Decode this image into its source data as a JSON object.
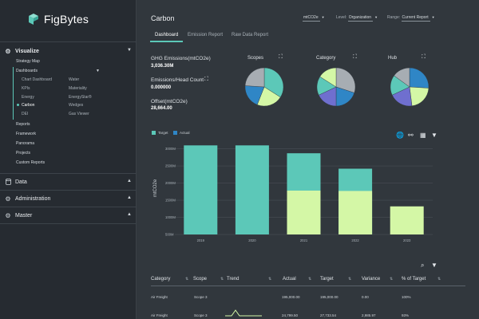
{
  "app": {
    "name": "FigBytes"
  },
  "sidebar": {
    "visualize_label": "Visualize",
    "strategy_map": "Strategy Map",
    "dashboards": "Dashboards",
    "dash_col1": [
      "Chart Dashboard",
      "KPIs",
      "Energy",
      "Carbon",
      "DEI"
    ],
    "dash_col2": [
      "Water",
      "Materiality",
      "EnergyStar®",
      "Wedges",
      "Gas Viewer"
    ],
    "reports": "Reports",
    "framework": "Framework",
    "panorama": "Panorama",
    "projects": "Projects",
    "custom_reports": "Custom Reports",
    "data_label": "Data",
    "administration_label": "Administration",
    "master_label": "Master"
  },
  "header": {
    "title": "Carbon",
    "unit": "mtCO2e",
    "level_label": "Level:",
    "level_value": "Organization",
    "range_label": "Range:",
    "range_value": "Current Report"
  },
  "tabs": [
    "Dashboard",
    "Emission Report",
    "Raw Data Report"
  ],
  "kpis": {
    "ghs_label": "GHG Emissions(mtCO2e)",
    "ghs_value": "3,036.30M",
    "perhead_label": "Emissions/Head Count",
    "perhead_value": "0.000000",
    "offset_label": "Offset(mtCO2e)",
    "offset_value": "28,664.00"
  },
  "pies": [
    {
      "title": "Scopes",
      "slices": [
        {
          "value": 34,
          "color": "#5cc8b8"
        },
        {
          "value": 22,
          "color": "#d4f7a6"
        },
        {
          "value": 20,
          "color": "#2f86c6"
        },
        {
          "value": 24,
          "color": "#a7adb3"
        }
      ]
    },
    {
      "title": "Category",
      "slices": [
        {
          "value": 30,
          "color": "#a7adb3"
        },
        {
          "value": 20,
          "color": "#2f86c6"
        },
        {
          "value": 18,
          "color": "#6f6fcf"
        },
        {
          "value": 16,
          "color": "#5cc8b8"
        },
        {
          "value": 16,
          "color": "#d4f7a6"
        }
      ]
    },
    {
      "title": "Hub",
      "slices": [
        {
          "value": 26,
          "color": "#2f86c6"
        },
        {
          "value": 22,
          "color": "#d4f7a6"
        },
        {
          "value": 20,
          "color": "#6f6fcf"
        },
        {
          "value": 17,
          "color": "#5cc8b8"
        },
        {
          "value": 15,
          "color": "#a7adb3"
        }
      ]
    }
  ],
  "legend": {
    "target": "Target",
    "actual": "Actual",
    "target_color": "#5cc8b8",
    "actual_color": "#d4f7a6"
  },
  "chart_data": {
    "type": "bar",
    "categories": [
      "2019",
      "2020",
      "2021",
      "2022",
      "2023"
    ],
    "series": [
      {
        "name": "Target",
        "values": [
          3100,
          3100,
          2870,
          2420,
          0
        ]
      },
      {
        "name": "Actual",
        "values": [
          0,
          0,
          1780,
          1770,
          1320
        ]
      }
    ],
    "ylabel": "mtCO2e",
    "yticks": [
      "500M",
      "1000M",
      "1500M",
      "2000M",
      "2500M",
      "3000M"
    ],
    "ylim": [
      500,
      3200
    ],
    "colors": {
      "Target": "#5cc8b8",
      "Actual": "#d4f7a6"
    }
  },
  "table": {
    "headers": [
      "Category",
      "Scope",
      "Trend",
      "Actual",
      "Target",
      "Variance",
      "% of Target"
    ],
    "rows": [
      [
        "Air Freight",
        "Scope 3",
        "",
        "195,000.00",
        "195,000.00",
        "0.00",
        "100%"
      ],
      [
        "Air Freight",
        "Scope 3",
        "",
        "24,799.50",
        "27,733.54",
        "2,985.97",
        "93%"
      ]
    ]
  },
  "icons": {
    "chart_tools": [
      "globe-icon",
      "network-icon",
      "table-icon",
      "download-icon"
    ],
    "table_tools": [
      "search-icon",
      "download-icon"
    ]
  }
}
